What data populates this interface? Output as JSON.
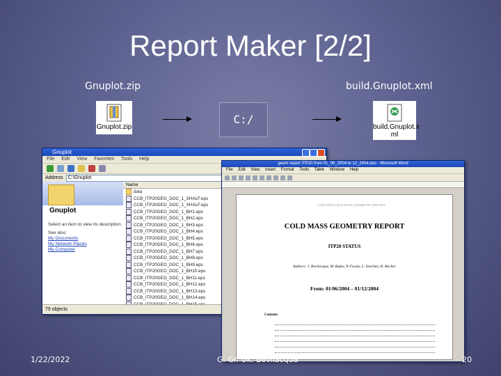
{
  "slide": {
    "title": "Report Maker [2/2]",
    "label_left": "Gnuplot.zip",
    "label_right": "build.Gnuplot.xml",
    "file_left": "Gnuplot.zip",
    "file_right_line1": "build.Gnuplot.x",
    "file_right_line2": "ml",
    "drive": "C:/",
    "date": "1/22/2022",
    "footer_text": "G. Gr. Uk. Bevilacqua",
    "page_number": "20"
  },
  "explorer": {
    "title": "Gnuplot",
    "menu": "File Edit View Favorites Tools Help",
    "address_label": "Address",
    "address_value": "C:\\Gnuplot",
    "folder_name": "Gnuplot",
    "task_text": "Select an item to view its description.",
    "see_also": "See also:",
    "links": [
      "My Documents",
      "My Network Places",
      "My Computer"
    ],
    "column_header": "Name",
    "rows": [
      "data",
      "CCB_ITP20GEO_DOC_1_SHALF.eps",
      "CCB_ITP20GEO_DOC_1_SHALF.eps",
      "CCB_ITP20GEO_DOC_1_BH1.eps",
      "CCB_ITP20GEO_DOC_1_BH2.eps",
      "CCB_ITP20GEO_DOC_1_BH3.eps",
      "CCB_ITP20GEO_DOC_1_BH4.eps",
      "CCB_ITP20GEO_DOC_1_BH5.eps",
      "CCB_ITP20GEO_DOC_1_BH6.eps",
      "CCB_ITP20GEO_DOC_1_BH7.eps",
      "CCB_ITP20GEO_DOC_1_BH8.eps",
      "CCB_ITP20GEO_DOC_1_BH9.eps",
      "CCB_ITP20GEO_DOC_1_BH10.eps",
      "CCB_ITP20GEO_DOC_1_BH11.eps",
      "CCB_ITP20GEO_DOC_1_BH12.eps",
      "CCB_ITP20GEO_DOC_1_BH13.eps",
      "CCB_ITP20GEO_DOC_1_BH14.eps",
      "CCB_ITP20GEO_DOC_1_BH15.eps"
    ],
    "status": "79 objects"
  },
  "word": {
    "title": "geom report ITP20 from 01_06_2004 to 12_2004.doc - Microsoft Word",
    "menu": "File Edit View Insert Format Tools Table Window Help",
    "header_line": "CCB ITP20 COLD MASS GEOMETRY REPORT",
    "doc_title": "COLD MASS GEOMETRY REPORT",
    "doc_status": "ITP20 STATUS",
    "authors": "Authors: J. Bevilacqua, M. Bajko, P. Fessia, L. Sanchez, D. Bucher",
    "date_range": "From:  01/06/2004 – 01/12/2004",
    "contents": "Contents"
  }
}
